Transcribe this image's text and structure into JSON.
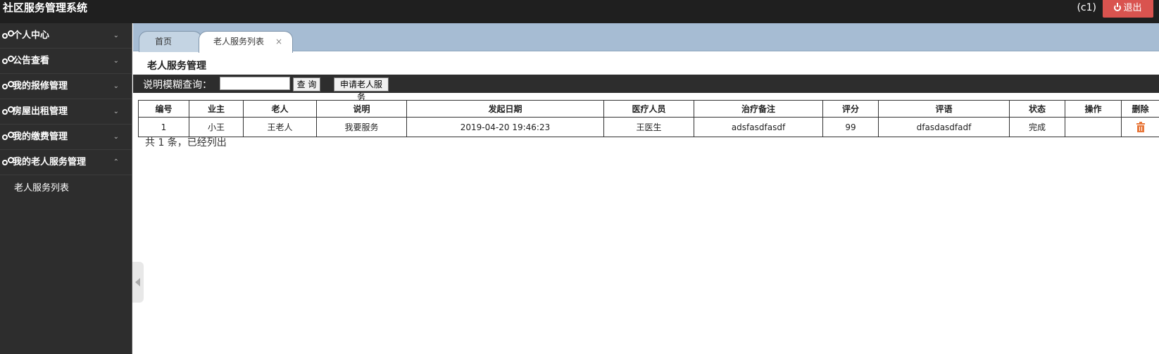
{
  "app": {
    "title": "社区服务管理系统",
    "user": "(c1)",
    "logout_label": "退出"
  },
  "sidebar": {
    "items": [
      {
        "label": "个人中心",
        "chevron": "⌄"
      },
      {
        "label": "公告查看",
        "chevron": "⌄"
      },
      {
        "label": "我的报修管理",
        "chevron": "⌄"
      },
      {
        "label": "房屋出租管理",
        "chevron": "⌄"
      },
      {
        "label": "我的缴费管理",
        "chevron": "⌄"
      },
      {
        "label": "我的老人服务管理",
        "chevron": "⌃"
      }
    ],
    "subitems": [
      {
        "label": "老人服务列表"
      }
    ]
  },
  "tabs": {
    "home": "首页",
    "active": "老人服务列表",
    "close": "×"
  },
  "main": {
    "title": "老人服务管理",
    "search": {
      "label": "说明模糊查询：",
      "value": "",
      "query_label": "查 询",
      "apply_label": "申请老人服务"
    },
    "table": {
      "headers": [
        "编号",
        "业主",
        "老人",
        "说明",
        "发起日期",
        "医疗人员",
        "治疗备注",
        "评分",
        "评语",
        "状态",
        "操作",
        "删除"
      ],
      "rows": [
        [
          "1",
          "小王",
          "王老人",
          "我要服务",
          "2019-04-20 19:46:23",
          "王医生",
          "adsfasdfasdf",
          "99",
          "dfasdasdfadf",
          "完成",
          ""
        ]
      ]
    },
    "footer": "共 1 条，已经列出"
  },
  "colors": {
    "topbar": "#1f1f1f",
    "sidebar": "#2d2d2d",
    "tabbar": "#a6bcd3",
    "logout": "#d9534f",
    "trash": "#e8773a"
  }
}
